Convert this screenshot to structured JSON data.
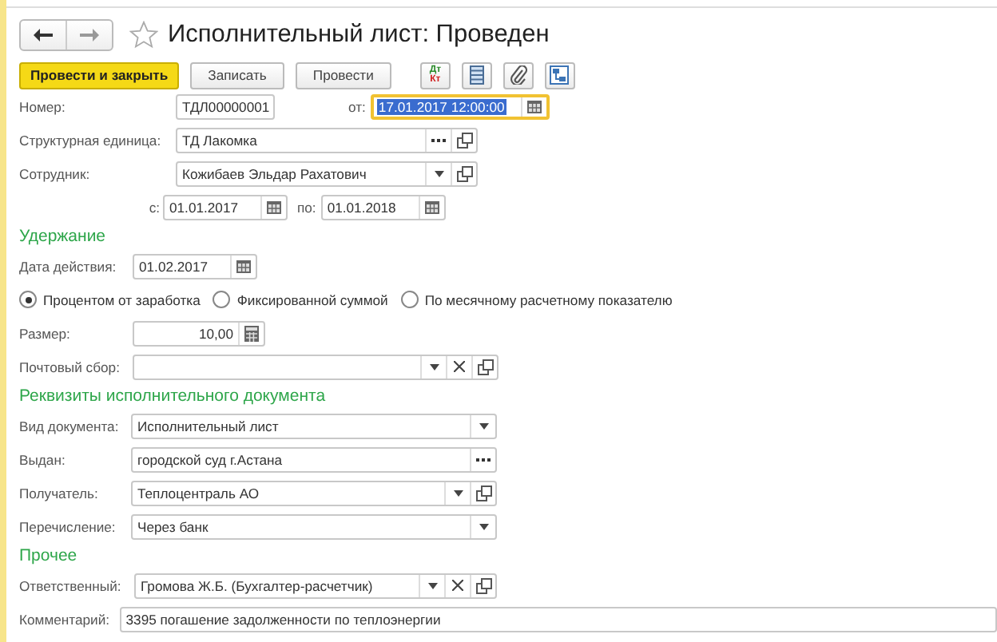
{
  "window": {
    "title": "Исполнительный лист: Проведен",
    "favorite": false
  },
  "toolbar": {
    "buttons": [
      {
        "label": "Провести и закрыть",
        "kind": "default"
      },
      {
        "label": "Записать",
        "kind": "normal"
      },
      {
        "label": "Провести",
        "kind": "normal"
      }
    ],
    "dt_kt": {
      "top": "Дт",
      "bottom": "Кт"
    },
    "icon_buttons": [
      {
        "kind": "list"
      },
      {
        "kind": "attach"
      },
      {
        "kind": "structure"
      }
    ]
  },
  "header": {
    "number_label": "Номер:",
    "number": "ТДЛ00000001",
    "date_label": "от:",
    "date": "17.01.2017 12:00:00",
    "date_focused": true,
    "unit_label": "Структурная единица:",
    "unit": "ТД Лакомка",
    "employee_label": "Сотрудник:",
    "employee": "Кожибаев Эльдар Рахатович",
    "from_label": "с:",
    "from": "01.01.2017",
    "to_label": "по:",
    "to": "01.01.2018"
  },
  "deduction": {
    "title": "Удержание",
    "date_label": "Дата действия:",
    "date": "01.02.2017",
    "methods": [
      {
        "label": "Процентом от заработка",
        "selected": true
      },
      {
        "label": "Фиксированной суммой",
        "selected": false
      },
      {
        "label": "По месячному расчетному показателю",
        "selected": false
      }
    ],
    "size_label": "Размер:",
    "size": "10,00",
    "postal_label": "Почтовый сбор:"
  },
  "requisites": {
    "title": "Реквизиты исполнительного документа",
    "rows": [
      {
        "label": "Вид документа:",
        "value": "Исполнительный лист",
        "buttons": [
          {
            "kind": "dropdown"
          }
        ]
      },
      {
        "label": "Выдан:",
        "value": "городской суд г.Астана",
        "buttons": [
          {
            "kind": "select"
          }
        ]
      },
      {
        "label": "Получатель:",
        "value": "Теплоцентраль АО",
        "buttons": [
          {
            "kind": "dropdown"
          },
          {
            "kind": "open"
          }
        ]
      },
      {
        "label": "Перечисление:",
        "value": "Через банк",
        "buttons": [
          {
            "kind": "dropdown"
          }
        ]
      }
    ]
  },
  "other": {
    "title": "Прочее",
    "responsible_label": "Ответственный:",
    "responsible": "Громова Ж.Б. (Бухгалтер-расчетчик)",
    "comment_label": "Комментарий:",
    "comment": "3395 погашение задолженности по теплоэнергии"
  }
}
